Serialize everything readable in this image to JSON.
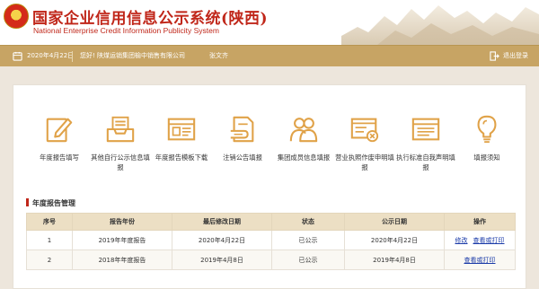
{
  "header": {
    "title_cn": "国家企业信用信息公示系统(陕西)",
    "title_en": "National Enterprise Credit Information Publicity System"
  },
  "topbar": {
    "date": "2020年4月22日",
    "greeting": "您好! 陕煤运销集团榆中销售有限公司",
    "user": "张文齐",
    "logout": "退出登录"
  },
  "tiles": [
    {
      "label": "年度报告填写",
      "icon": "pen-paper-icon"
    },
    {
      "label": "其他自行公示信息填报",
      "icon": "inbox-tray-icon"
    },
    {
      "label": "年度报告模板下载",
      "icon": "browser-window-icon"
    },
    {
      "label": "注销公告填报",
      "icon": "document-hand-icon"
    },
    {
      "label": "集团成员信息填报",
      "icon": "group-users-icon"
    },
    {
      "label": "营业执照作废申明填报",
      "icon": "license-cancel-icon"
    },
    {
      "label": "执行标准自我声明填报",
      "icon": "standard-statement-icon"
    },
    {
      "label": "填报须知",
      "icon": "lightbulb-icon"
    }
  ],
  "section": {
    "title": "年度报告管理"
  },
  "table": {
    "headers": [
      "序号",
      "报告年份",
      "最后修改日期",
      "状态",
      "公示日期",
      "操作"
    ],
    "rows": [
      {
        "no": "1",
        "year": "2019年年度报告",
        "modified": "2020年4月22日",
        "status": "已公示",
        "published": "2020年4月22日",
        "actions": [
          "修改",
          "查看或打印"
        ]
      },
      {
        "no": "2",
        "year": "2018年年度报告",
        "modified": "2019年4月8日",
        "status": "已公示",
        "published": "2019年4月8日",
        "actions": [
          "查看或打印"
        ]
      }
    ]
  },
  "colors": {
    "brand_red": "#c0271a",
    "gold": "#c7a464",
    "icon": "#e0a248",
    "link": "#1a3aa8"
  }
}
